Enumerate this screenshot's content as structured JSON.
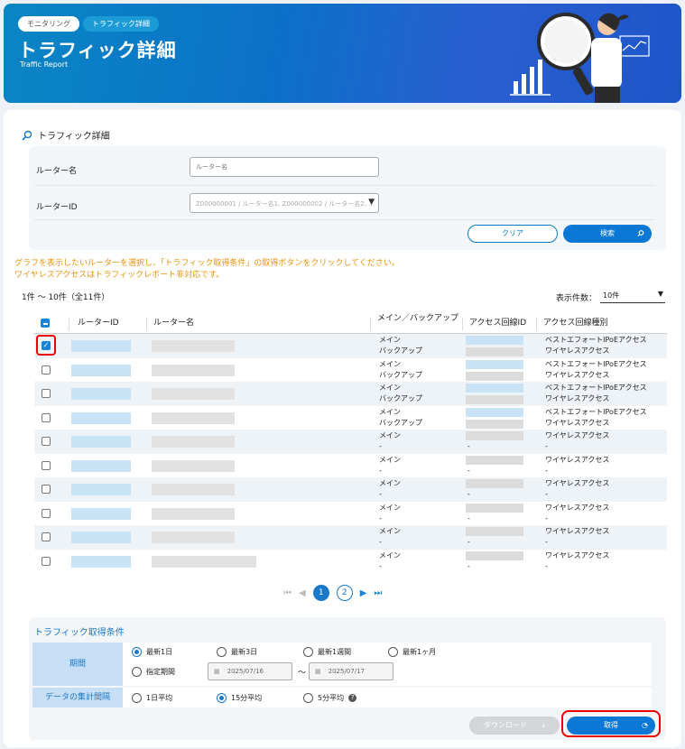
{
  "header": {
    "breadcrumbs": [
      "モニタリング",
      "トラフィック詳細"
    ],
    "title": "トラフィック詳細",
    "subtitle": "Traffic Report"
  },
  "search": {
    "section_title": "トラフィック詳細",
    "router_name_label": "ルーター名",
    "router_name_placeholder": "ルーター名",
    "router_id_label": "ルーターID",
    "router_id_placeholder": "Z000000001 / ルーター名1, Z000000002 / ルーター名2, ...",
    "clear_label": "クリア",
    "search_label": "検索"
  },
  "notice": {
    "line1": "グラフを表示したいルーターを選択し、「トラフィック取得条件」の取得ボタンをクリックしてください。",
    "line2": "ワイヤレスアクセスはトラフィックレポート非対応です。"
  },
  "list": {
    "count_text": "1件 ～ 10件（全11件）",
    "per_page_label": "表示件数：",
    "per_page_value": "10件",
    "columns": [
      "ルーターID",
      "ルーター名",
      "メイン／バックアップ",
      "アクセス回線ID",
      "アクセス回線種別"
    ],
    "rows": [
      {
        "checked": true,
        "role1": "メイン",
        "role2": "バックアップ",
        "type1": "ベストエフォートIPoEアクセス",
        "type2": "ワイヤレスアクセス",
        "acc2": ""
      },
      {
        "checked": false,
        "role1": "メイン",
        "role2": "バックアップ",
        "type1": "ベストエフォートIPoEアクセス",
        "type2": "ワイヤレスアクセス",
        "acc2": ""
      },
      {
        "checked": false,
        "role1": "メイン",
        "role2": "バックアップ",
        "type1": "ベストエフォートIPoEアクセス",
        "type2": "ワイヤレスアクセス",
        "acc2": ""
      },
      {
        "checked": false,
        "role1": "メイン",
        "role2": "バックアップ",
        "type1": "ベストエフォートIPoEアクセス",
        "type2": "ワイヤレスアクセス",
        "acc2": ""
      },
      {
        "checked": false,
        "role1": "メイン",
        "role2": "-",
        "type1": "ワイヤレスアクセス",
        "type2": "-",
        "acc2": "-"
      },
      {
        "checked": false,
        "role1": "メイン",
        "role2": "-",
        "type1": "ワイヤレスアクセス",
        "type2": "-",
        "acc2": "-"
      },
      {
        "checked": false,
        "role1": "メイン",
        "role2": "-",
        "type1": "ワイヤレスアクセス",
        "type2": "-",
        "acc2": "-"
      },
      {
        "checked": false,
        "role1": "メイン",
        "role2": "-",
        "type1": "ワイヤレスアクセス",
        "type2": "-",
        "acc2": "-"
      },
      {
        "checked": false,
        "role1": "メイン",
        "role2": "-",
        "type1": "ワイヤレスアクセス",
        "type2": "-",
        "acc2": "-"
      },
      {
        "checked": false,
        "role1": "メイン",
        "role2": "-",
        "type1": "ワイヤレスアクセス",
        "type2": "-",
        "acc2": "-"
      }
    ]
  },
  "pagination": {
    "pages": [
      "1",
      "2"
    ],
    "current": "1"
  },
  "conditions": {
    "title": "トラフィック取得条件",
    "period_label": "期間",
    "period_options": [
      "最新1日",
      "最新3日",
      "最新1週間",
      "最新1ヶ月"
    ],
    "custom_label": "指定期間",
    "date_from": "2025/07/16",
    "date_sep": "～",
    "date_to": "2025/07/17",
    "interval_label": "データの集計間隔",
    "interval_options": [
      "1日平均",
      "15分平均",
      "5分平均"
    ],
    "download_label": "ダウンロード",
    "get_label": "取得"
  },
  "colors": {
    "primary": "#0a78d4",
    "notice": "#e8930c",
    "highlight": "#e00000"
  }
}
